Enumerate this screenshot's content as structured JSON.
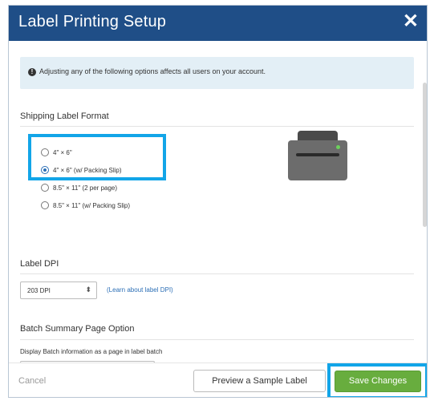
{
  "dialog": {
    "title": "Label Printing Setup",
    "close_glyph": "✕"
  },
  "info_banner": {
    "icon": "info-icon",
    "icon_glyph": "!",
    "text": "Adjusting any of the following options affects all users on your account."
  },
  "shipping_label_format": {
    "heading": "Shipping Label Format",
    "options": [
      {
        "label": "4\" × 6\"",
        "checked": false
      },
      {
        "label": "4\" × 6\" (w/ Packing Slip)",
        "checked": true
      },
      {
        "label": "8.5\" × 11\" (2 per page)",
        "checked": false
      },
      {
        "label": "8.5\" × 11\" (w/ Packing Slip)",
        "checked": false
      }
    ],
    "printer_icon": "printer-icon"
  },
  "label_dpi": {
    "heading": "Label DPI",
    "selected": "203 DPI",
    "arrow_glyph": "⬍",
    "learn_link": "(Learn about label DPI)"
  },
  "batch_summary": {
    "heading": "Batch Summary Page Option",
    "description": "Display Batch information as a page in label batch"
  },
  "footer": {
    "cancel_label": "Cancel",
    "preview_label": "Preview a Sample Label",
    "save_label": "Save Changes"
  },
  "colors": {
    "header_bg": "#1f4e87",
    "highlight": "#12a5e8",
    "save_button": "#68ad3e",
    "info_bg": "#e3eff6",
    "link": "#2c6fb6"
  }
}
